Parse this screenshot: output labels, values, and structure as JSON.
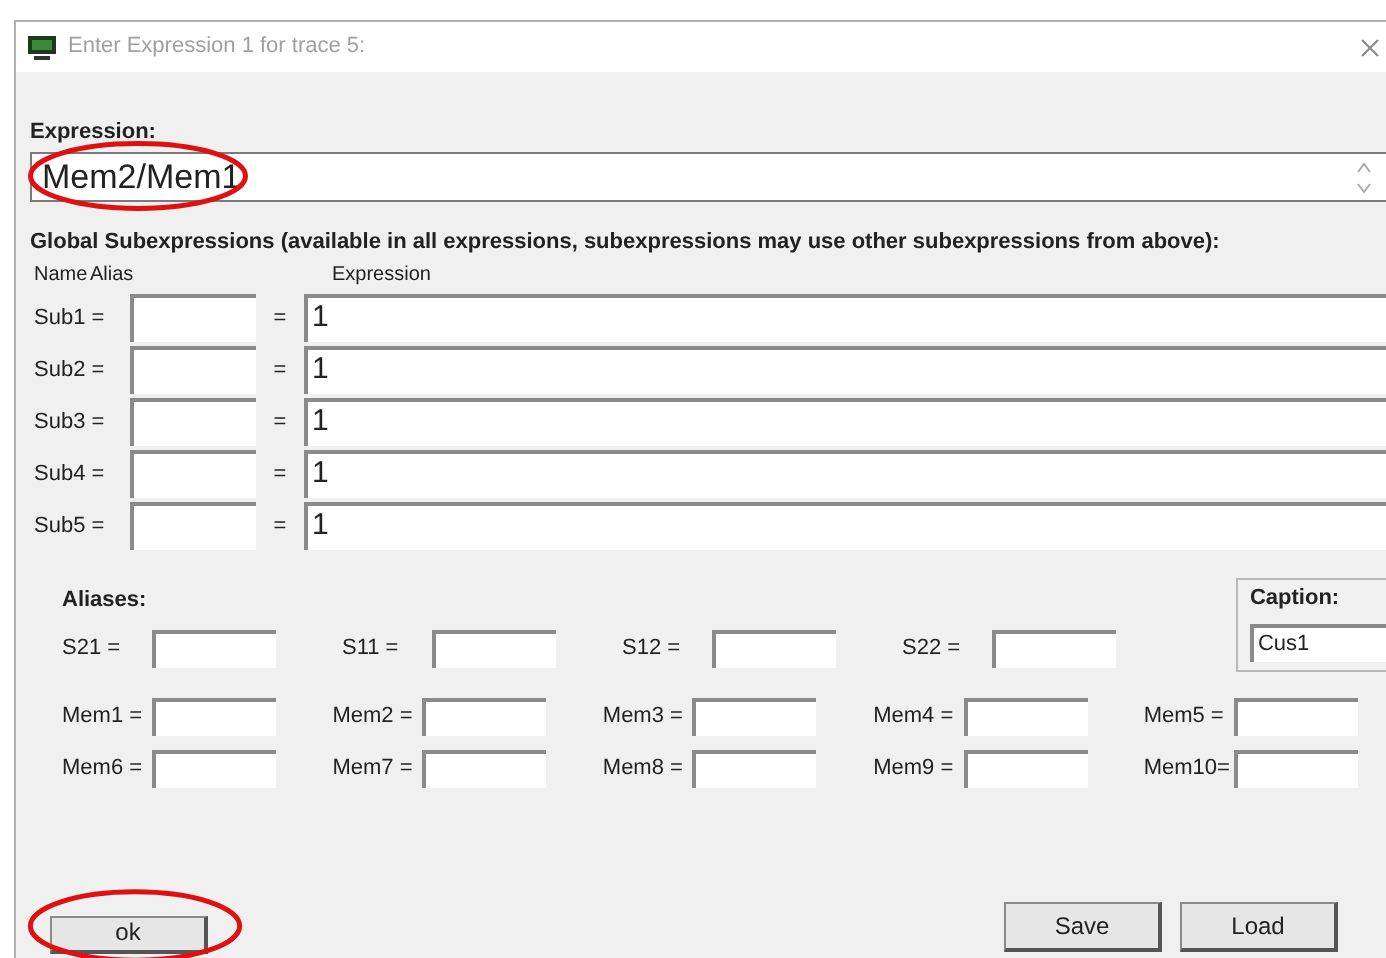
{
  "window": {
    "title": "Enter Expression 1 for trace 5:"
  },
  "expression": {
    "label": "Expression:",
    "value": "Mem2/Mem1",
    "highlighted": true
  },
  "subexpressions": {
    "heading": "Global Subexpressions (available in all expressions, subexpressions may use other subexpressions from above):",
    "columns": [
      "Name",
      "Alias",
      "Expression"
    ],
    "rows": [
      {
        "name": "Sub1 =",
        "equals": "=",
        "expression": "1"
      },
      {
        "name": "Sub2 =",
        "equals": "=",
        "expression": "1"
      },
      {
        "name": "Sub3 =",
        "equals": "=",
        "expression": "1"
      },
      {
        "name": "Sub4 =",
        "equals": "=",
        "expression": "1"
      },
      {
        "name": "Sub5 =",
        "equals": "=",
        "expression": "1"
      }
    ]
  },
  "aliases": {
    "heading": "Aliases:",
    "s_params": [
      "S21 =",
      "S11 =",
      "S12 =",
      "S22 ="
    ],
    "memories": [
      [
        "Mem1 =",
        "Mem2 =",
        "Mem3 =",
        "Mem4 =",
        "Mem5 ="
      ],
      [
        "Mem6 =",
        "Mem7 =",
        "Mem8 =",
        "Mem9 =",
        "Mem10="
      ]
    ]
  },
  "caption": {
    "label": "Caption:",
    "value": "Cus1"
  },
  "buttons": [
    {
      "label": "ok",
      "highlighted": true
    },
    {
      "label": "Save",
      "highlighted": false
    },
    {
      "label": "Load",
      "highlighted": false
    }
  ]
}
